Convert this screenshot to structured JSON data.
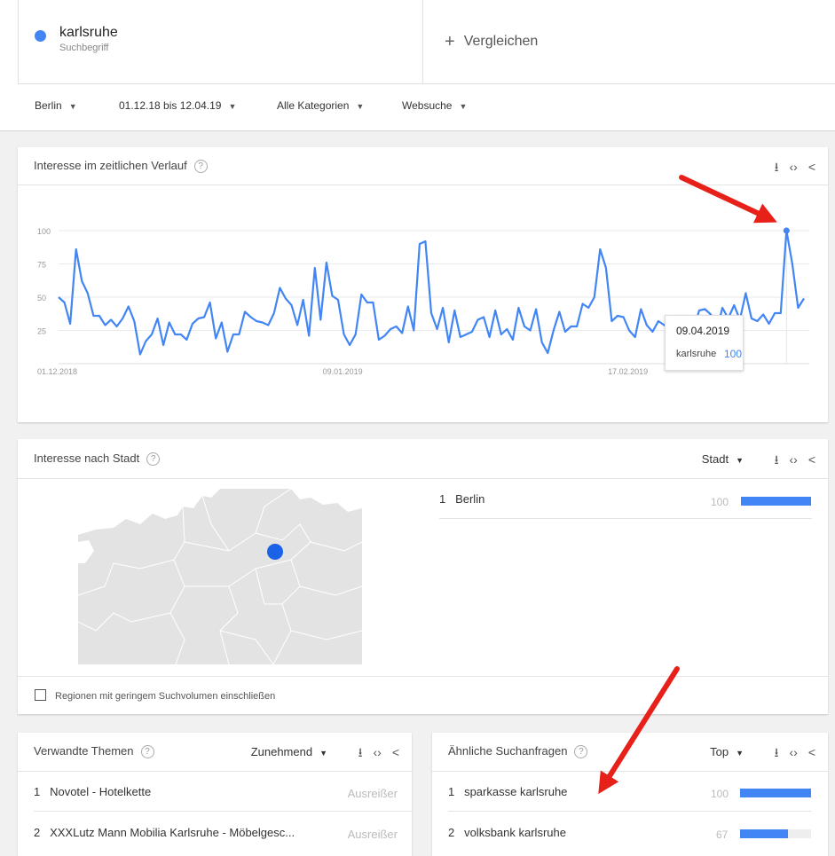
{
  "search": {
    "term": "karlsruhe",
    "term_type": "Suchbegriff",
    "compare_label": "Vergleichen",
    "compare_plus": "+"
  },
  "filters": {
    "region": "Berlin",
    "date_range": "01.12.18 bis 12.04.19",
    "category": "Alle Kategorien",
    "search_type": "Websuche"
  },
  "icons": {
    "download": "download-icon",
    "embed": "embed-icon",
    "share": "share-icon",
    "help": "help-icon",
    "caret": "caret-down-icon"
  },
  "glyphs": {
    "help": "?",
    "caret": "▼",
    "download": "⭳",
    "embed": "‹›",
    "share": "<"
  },
  "colors": {
    "accent": "#4285f4",
    "arrow": "#e8201a"
  },
  "time_card": {
    "title": "Interesse im zeitlichen Verlauf",
    "tooltip": {
      "date": "09.04.2019",
      "term": "karlsruhe",
      "value": "100"
    }
  },
  "chart_data": {
    "type": "line",
    "title": "Interesse im zeitlichen Verlauf",
    "x_tick_labels": [
      "01.12.2018",
      "09.01.2019",
      "17.02.2019"
    ],
    "y_tick_labels": [
      "100",
      "75",
      "50",
      "25"
    ],
    "ylim": [
      0,
      100
    ],
    "grid": true,
    "series": [
      {
        "name": "karlsruhe",
        "values": [
          50,
          46,
          30,
          86,
          62,
          53,
          36,
          36,
          29,
          33,
          28,
          34,
          43,
          32,
          7,
          17,
          22,
          34,
          14,
          31,
          22,
          22,
          18,
          30,
          34,
          35,
          46,
          19,
          31,
          9,
          22,
          22,
          39,
          35,
          32,
          31,
          29,
          38,
          57,
          49,
          44,
          29,
          48,
          21,
          72,
          33,
          76,
          51,
          48,
          22,
          14,
          22,
          52,
          46,
          46,
          18,
          21,
          26,
          28,
          23,
          43,
          25,
          90,
          92,
          38,
          26,
          42,
          16,
          40,
          20,
          22,
          24,
          33,
          35,
          20,
          40,
          22,
          26,
          18,
          42,
          28,
          25,
          41,
          16,
          8,
          25,
          39,
          24,
          28,
          28,
          45,
          42,
          50,
          86,
          72,
          32,
          36,
          35,
          25,
          20,
          41,
          29,
          24,
          32,
          29,
          26,
          20,
          36,
          33,
          24,
          40,
          41,
          37,
          24,
          42,
          34,
          44,
          33,
          53,
          34,
          32,
          37,
          30,
          38,
          38,
          100,
          75,
          42,
          49
        ]
      }
    ]
  },
  "city_card": {
    "title": "Interesse nach Stadt",
    "selector": "Stadt",
    "rows": [
      {
        "rank": "1",
        "name": "Berlin",
        "score": "100",
        "fraction": 1.0
      }
    ],
    "checkbox_label": "Regionen mit geringem Suchvolumen einschließen"
  },
  "topics_card": {
    "title": "Verwandte Themen",
    "selector": "Zunehmend",
    "rows": [
      {
        "rank": "1",
        "name": "Novotel - Hotelkette",
        "value": "Ausreißer"
      },
      {
        "rank": "2",
        "name": "XXXLutz Mann Mobilia Karlsruhe - Möbelgesc...",
        "value": "Ausreißer"
      }
    ]
  },
  "queries_card": {
    "title": "Ähnliche Suchanfragen",
    "selector": "Top",
    "rows": [
      {
        "rank": "1",
        "name": "sparkasse karlsruhe",
        "score": "100",
        "fraction": 1.0
      },
      {
        "rank": "2",
        "name": "volksbank karlsruhe",
        "score": "67",
        "fraction": 0.67
      }
    ]
  }
}
